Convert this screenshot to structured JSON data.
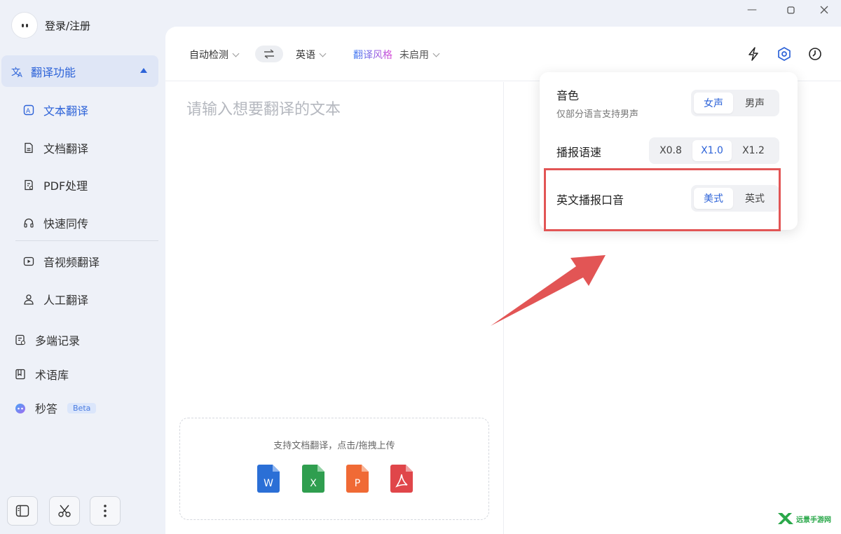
{
  "user": {
    "login_label": "登录/注册"
  },
  "nav": {
    "group_label": "翻译功能",
    "sub_items": [
      {
        "label": "文本翻译"
      },
      {
        "label": "文档翻译"
      },
      {
        "label": "PDF处理"
      },
      {
        "label": "快速同传"
      },
      {
        "label": "音视频翻译"
      },
      {
        "label": "人工翻译"
      }
    ],
    "items": [
      {
        "label": "多端记录"
      },
      {
        "label": "术语库"
      },
      {
        "label": "秒答",
        "badge": "Beta"
      }
    ]
  },
  "topbar": {
    "source_lang": "自动检测",
    "target_lang": "英语",
    "style_label": "翻译风格",
    "style_value": "未启用"
  },
  "editor": {
    "placeholder": "请输入想要翻译的文本",
    "upload_hint": "支持文档翻译，点击/拖拽上传",
    "file_types": [
      "W",
      "X",
      "P",
      "PDF"
    ]
  },
  "popup": {
    "voice": {
      "label": "音色",
      "sub": "仅部分语言支持男声",
      "options": [
        "女声",
        "男声"
      ],
      "selected": "女声"
    },
    "speed": {
      "label": "播报语速",
      "options": [
        "X0.8",
        "X1.0",
        "X1.2"
      ],
      "selected": "X1.0"
    },
    "accent": {
      "label": "英文播报口音",
      "options": [
        "美式",
        "英式"
      ],
      "selected": "美式"
    }
  },
  "watermark": {
    "text": "远景手游网"
  },
  "colors": {
    "accent": "#2d63d8",
    "highlight": "#e25555",
    "word": "#2b6fd6",
    "excel": "#2f9e4f",
    "ppt": "#f06a35",
    "pdf": "#e0464a"
  }
}
